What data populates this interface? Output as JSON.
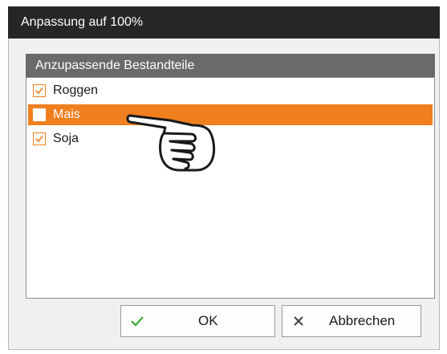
{
  "dialog": {
    "title": "Anpassung auf 100%",
    "group_header": "Anzupassende Bestandteile"
  },
  "ingredients": [
    {
      "label": "Roggen",
      "checked": true,
      "selected": false
    },
    {
      "label": "Mais",
      "checked": false,
      "selected": true
    },
    {
      "label": "Soja",
      "checked": true,
      "selected": false
    }
  ],
  "buttons": {
    "ok_label": "OK",
    "cancel_label": "Abbrechen",
    "ok_icon": "checkmark-icon",
    "cancel_icon": "x-icon"
  },
  "colors": {
    "titlebar": "#262626",
    "group_header": "#6a6a6a",
    "accent": "#f07f1e",
    "ok_icon": "#3aaa35"
  },
  "cursor_icon": "pointing-hand-cursor-icon"
}
